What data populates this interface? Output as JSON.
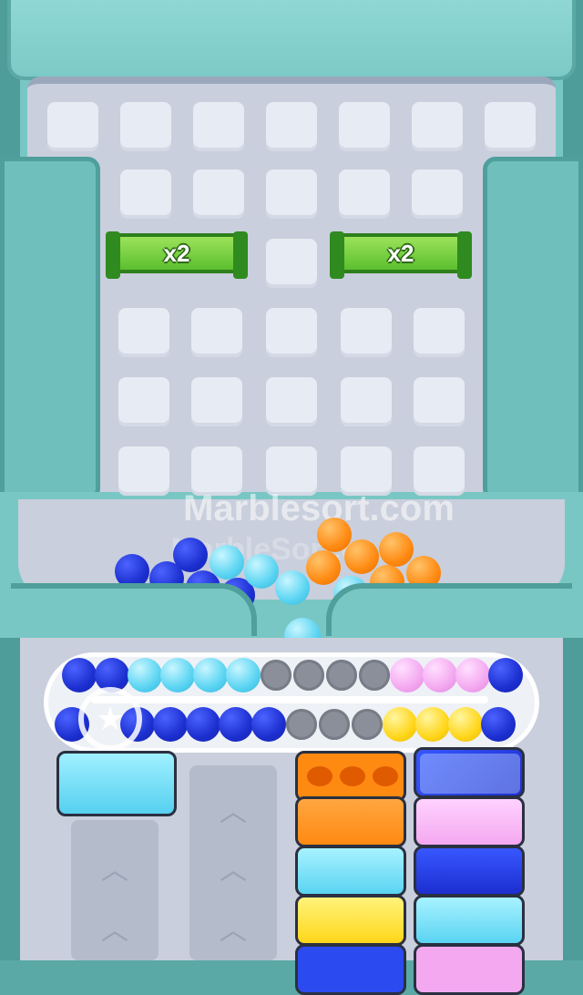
{
  "watermark": {
    "text": "Marblesort.com",
    "ghost_text": "MarbleSort.com"
  },
  "board": {
    "bonus_left": "x2",
    "bonus_right": "x2"
  },
  "icons": {
    "star": "star-icon",
    "chevron": "chevron-up-icon"
  },
  "colors": {
    "navy": "#1c2fd0",
    "cyan": "#5ad4f2",
    "orange": "#ff8a12",
    "pink": "#f4a8f0",
    "yellow": "#ffd61a",
    "frame": "#79c7c4"
  },
  "track": {
    "top_row": [
      "navy",
      "navy",
      "cyan",
      "cyan",
      "cyan",
      "cyan",
      "empty",
      "empty",
      "empty",
      "empty",
      "pink",
      "pink",
      "pink",
      "navy"
    ],
    "bottom_row": [
      "navy",
      "star",
      "navy",
      "navy",
      "navy",
      "navy",
      "navy",
      "empty",
      "empty",
      "empty",
      "yellow",
      "yellow",
      "yellow",
      "navy"
    ]
  },
  "stacks": [
    {
      "name": "column-1",
      "blocks": [
        "cyan"
      ]
    },
    {
      "name": "column-2",
      "blocks": []
    },
    {
      "name": "column-3",
      "blocks": [
        "orange-slots",
        "orange",
        "cyan",
        "yellow"
      ]
    },
    {
      "name": "column-4",
      "blocks": [
        "navy-ice",
        "pink",
        "navy",
        "cyan"
      ]
    }
  ]
}
